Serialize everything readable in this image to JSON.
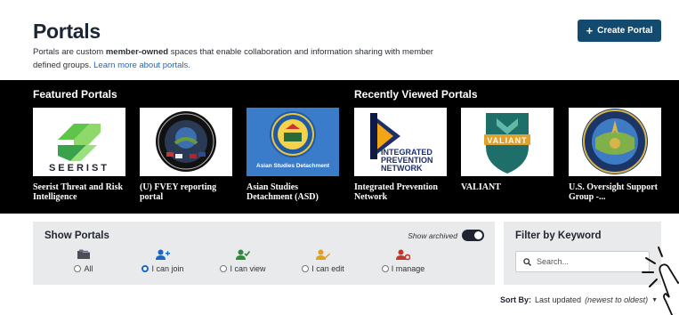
{
  "header": {
    "title": "Portals",
    "desc_prefix": "Portals are custom ",
    "desc_bold": "member-owned",
    "desc_suffix": " spaces that enable collaboration and information sharing with member defined groups. ",
    "learn_more": "Learn more about portals.",
    "create_label": "Create Portal"
  },
  "featured": {
    "heading": "Featured Portals",
    "tiles": [
      {
        "caption": "Seerist Threat and Risk Intelligence",
        "logo_text": "SEERIST"
      },
      {
        "caption": "(U) FVEY reporting portal"
      },
      {
        "caption": "Asian Studies Detachment (ASD)",
        "logo_text": "Asian Studies Detachment"
      }
    ]
  },
  "recent": {
    "heading": "Recently Viewed Portals",
    "tiles": [
      {
        "caption": "Integrated Prevention Network",
        "logo_text": "INTEGRATED PREVENTION NETWORK"
      },
      {
        "caption": "VALIANT",
        "logo_text": "VALIANT"
      },
      {
        "caption": "U.S. Oversight Support Group -..."
      }
    ]
  },
  "show_portals": {
    "title": "Show Portals",
    "archived_label": "Show archived",
    "options": [
      {
        "label": "All",
        "icon": "folder-icon",
        "color": "#4a4f57"
      },
      {
        "label": "I can join",
        "icon": "user-plus-icon",
        "color": "#1967c4",
        "selected": true
      },
      {
        "label": "I can view",
        "icon": "user-check-icon",
        "color": "#2e8b3a"
      },
      {
        "label": "I can edit",
        "icon": "user-edit-icon",
        "color": "#e0a020"
      },
      {
        "label": "I manage",
        "icon": "user-gear-icon",
        "color": "#c0392b"
      }
    ]
  },
  "filter": {
    "title": "Filter by Keyword",
    "placeholder": "Search..."
  },
  "sort": {
    "label": "Sort By:",
    "value": "Last updated",
    "detail": "(newest to oldest)"
  }
}
